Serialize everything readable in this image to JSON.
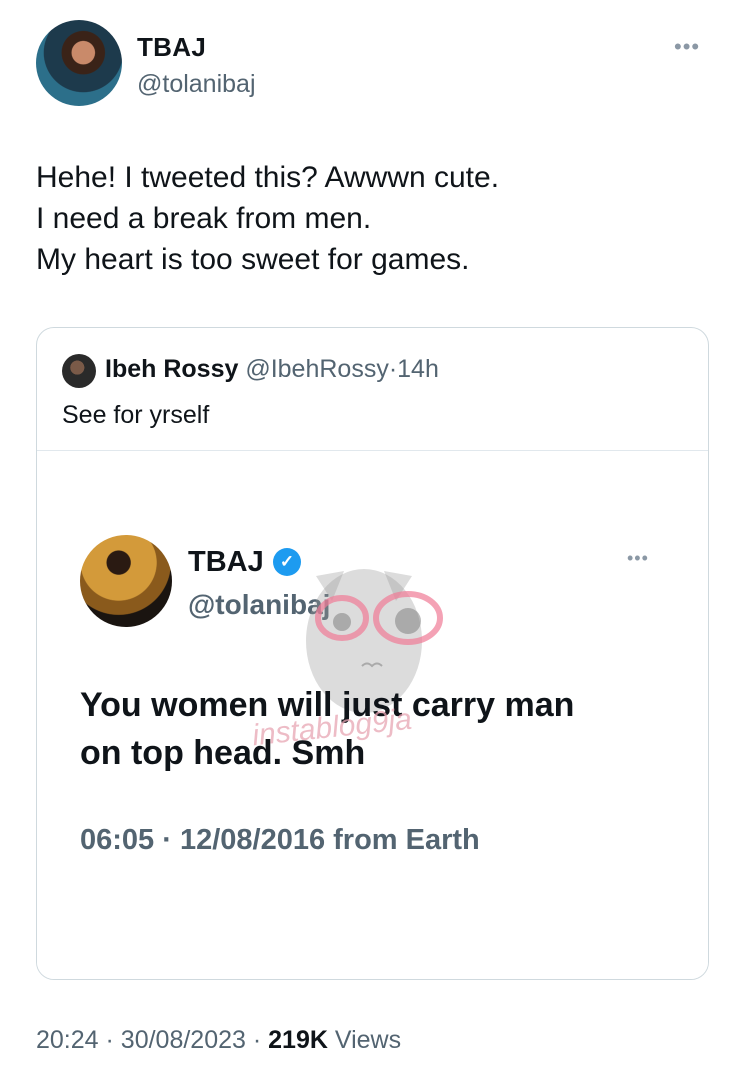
{
  "tweet": {
    "author_name": "TBAJ",
    "author_handle": "@tolanibaj",
    "more_icon": "more-horizontal-icon",
    "text_lines": [
      "Hehe! I tweeted this? Awwwn cute.",
      "I need a break from men.",
      "My heart is too sweet for games."
    ],
    "time": "20:24",
    "date": "30/08/2023",
    "views_count": "219K",
    "views_label": "Views",
    "separator": "·"
  },
  "quote": {
    "author_name": "Ibeh Rossy",
    "author_handle": "@IbehRossy",
    "separator": "·",
    "time": "14h",
    "text": "See for yrself"
  },
  "embedded_image": {
    "author_name": "TBAJ",
    "author_handle": "@tolanibaj",
    "verified_icon": "verified-badge-icon",
    "text_lines": [
      "You women will just carry man",
      "on top head. Smh"
    ],
    "timestamp": "06:05 · 12/08/2016 from Earth",
    "watermark": "instablog9ja"
  },
  "colors": {
    "text_primary": "#0f1419",
    "text_secondary": "#536471",
    "border": "#cfd9de",
    "verified": "#1d9bf0"
  }
}
